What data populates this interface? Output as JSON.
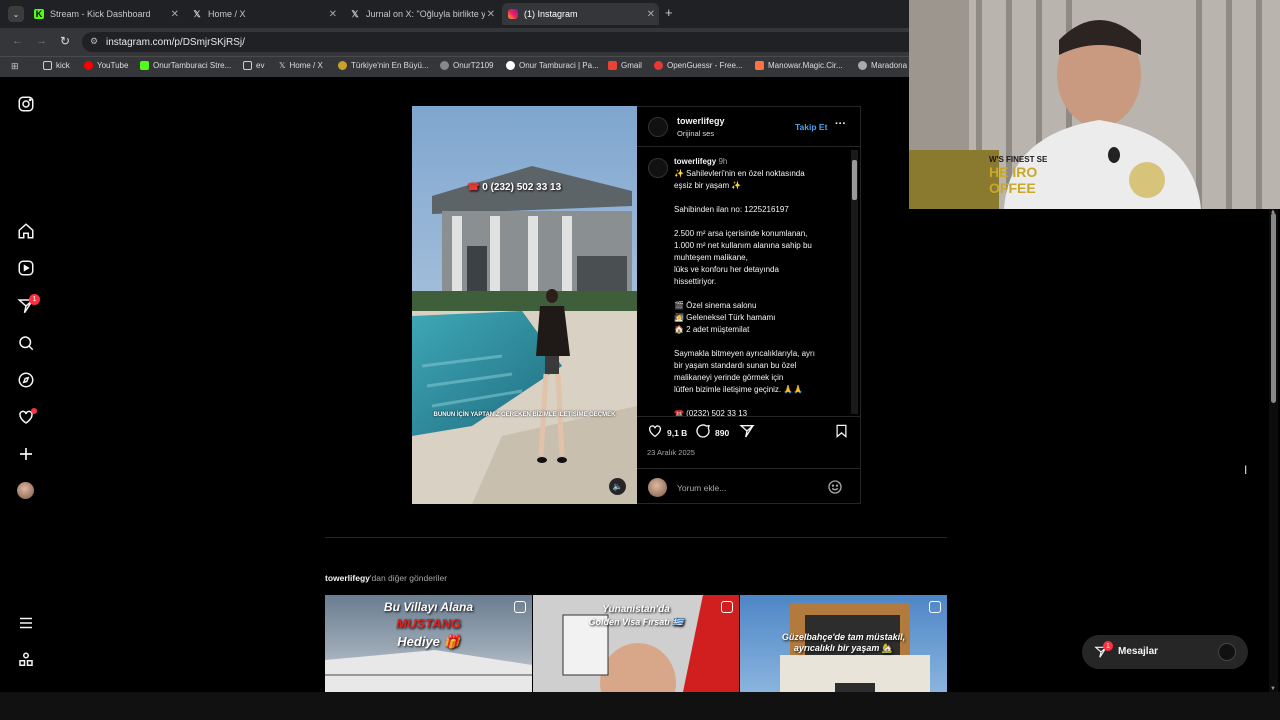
{
  "tabs": [
    {
      "label": "Stream - Kick Dashboard",
      "icon": "kick-icon"
    },
    {
      "label": "Home / X",
      "icon": "x-icon"
    },
    {
      "label": "Jurnal on X: \"Oğluyla birlikte ya",
      "icon": "x-icon"
    },
    {
      "label": "(1) Instagram",
      "icon": "instagram-icon"
    }
  ],
  "url": "instagram.com/p/DSmjrSKjRSj/",
  "bookmarks": [
    "kick",
    "YouTube",
    "OnurTamburaci Stre...",
    "ev",
    "Home / X",
    "Türkiye'nin En Büyü...",
    "OnurT2109",
    "Onur Tamburaci | Pa...",
    "Gmail",
    "OpenGuessr - Free...",
    "Manowar.Magic.Cir...",
    "Maradona"
  ],
  "sidebar": {
    "notification_badge": "1"
  },
  "post": {
    "username": "towerlifegy",
    "audio": "Orijinal ses",
    "follow_label": "Takip Et",
    "phone_overlay": "0 (232) 502 33 13",
    "subtitle_overlay": "BUNUN İÇİN YAPTANIZ GEREKEN BİZİMLE İLETİŞİME GEÇMEK",
    "caption_user": "towerlifegy",
    "caption_time": "9h",
    "caption_lines": [
      "✨ Sahilevleri'nin en özel noktasında",
      "eşsiz bir yaşam ✨",
      "",
      "Sahibinden ilan no: 1225216197",
      "",
      "2.500 m² arsa içerisinde konumlanan,",
      "1.000 m² net kullanım alanına sahip bu",
      "muhteşem malikane,",
      "lüks ve konforu her detayında",
      "hissettiriyor.",
      "",
      "🎬 Özel sinema salonu",
      "🧖 Geleneksel Türk hamamı",
      "🏠 2 adet müştemilat",
      "",
      "Saymakla bitmeyen ayrıcalıklarıyla, ayrı",
      "bir yaşam standardı sunan bu özel",
      "malikaneyi yerinde görmek için",
      "lütfen bizimle iletişime geçiniz. 🙏🙏",
      "",
      "☎️ (0232) 502 33 13"
    ],
    "likes": "9,1 B",
    "comments": "890",
    "date": "23 Aralık 2025",
    "comment_placeholder": "Yorum ekle..."
  },
  "more_posts_user": "towerlifegy",
  "more_posts_suffix": "'dan diğer gönderiler",
  "thumbs": [
    {
      "line1": "Bu Villayı Alana",
      "line2": "MUSTANG",
      "line3": "Hediye 🎁"
    },
    {
      "line1": "Yunanistan'da",
      "line2": "Golden Visa Fırsatı 🇬🇷"
    },
    {
      "line1": "Güzelbahçe'de tam müstakil,",
      "line2": "ayrıcalıklı bir yaşam 🏡"
    }
  ],
  "messages": {
    "label": "Mesajlar",
    "badge": "1"
  },
  "webcam": {
    "shirt_text_1": "W'S FINEST SE",
    "shirt_text_2": "HE IRO",
    "shirt_text_3": "OFFEE"
  }
}
